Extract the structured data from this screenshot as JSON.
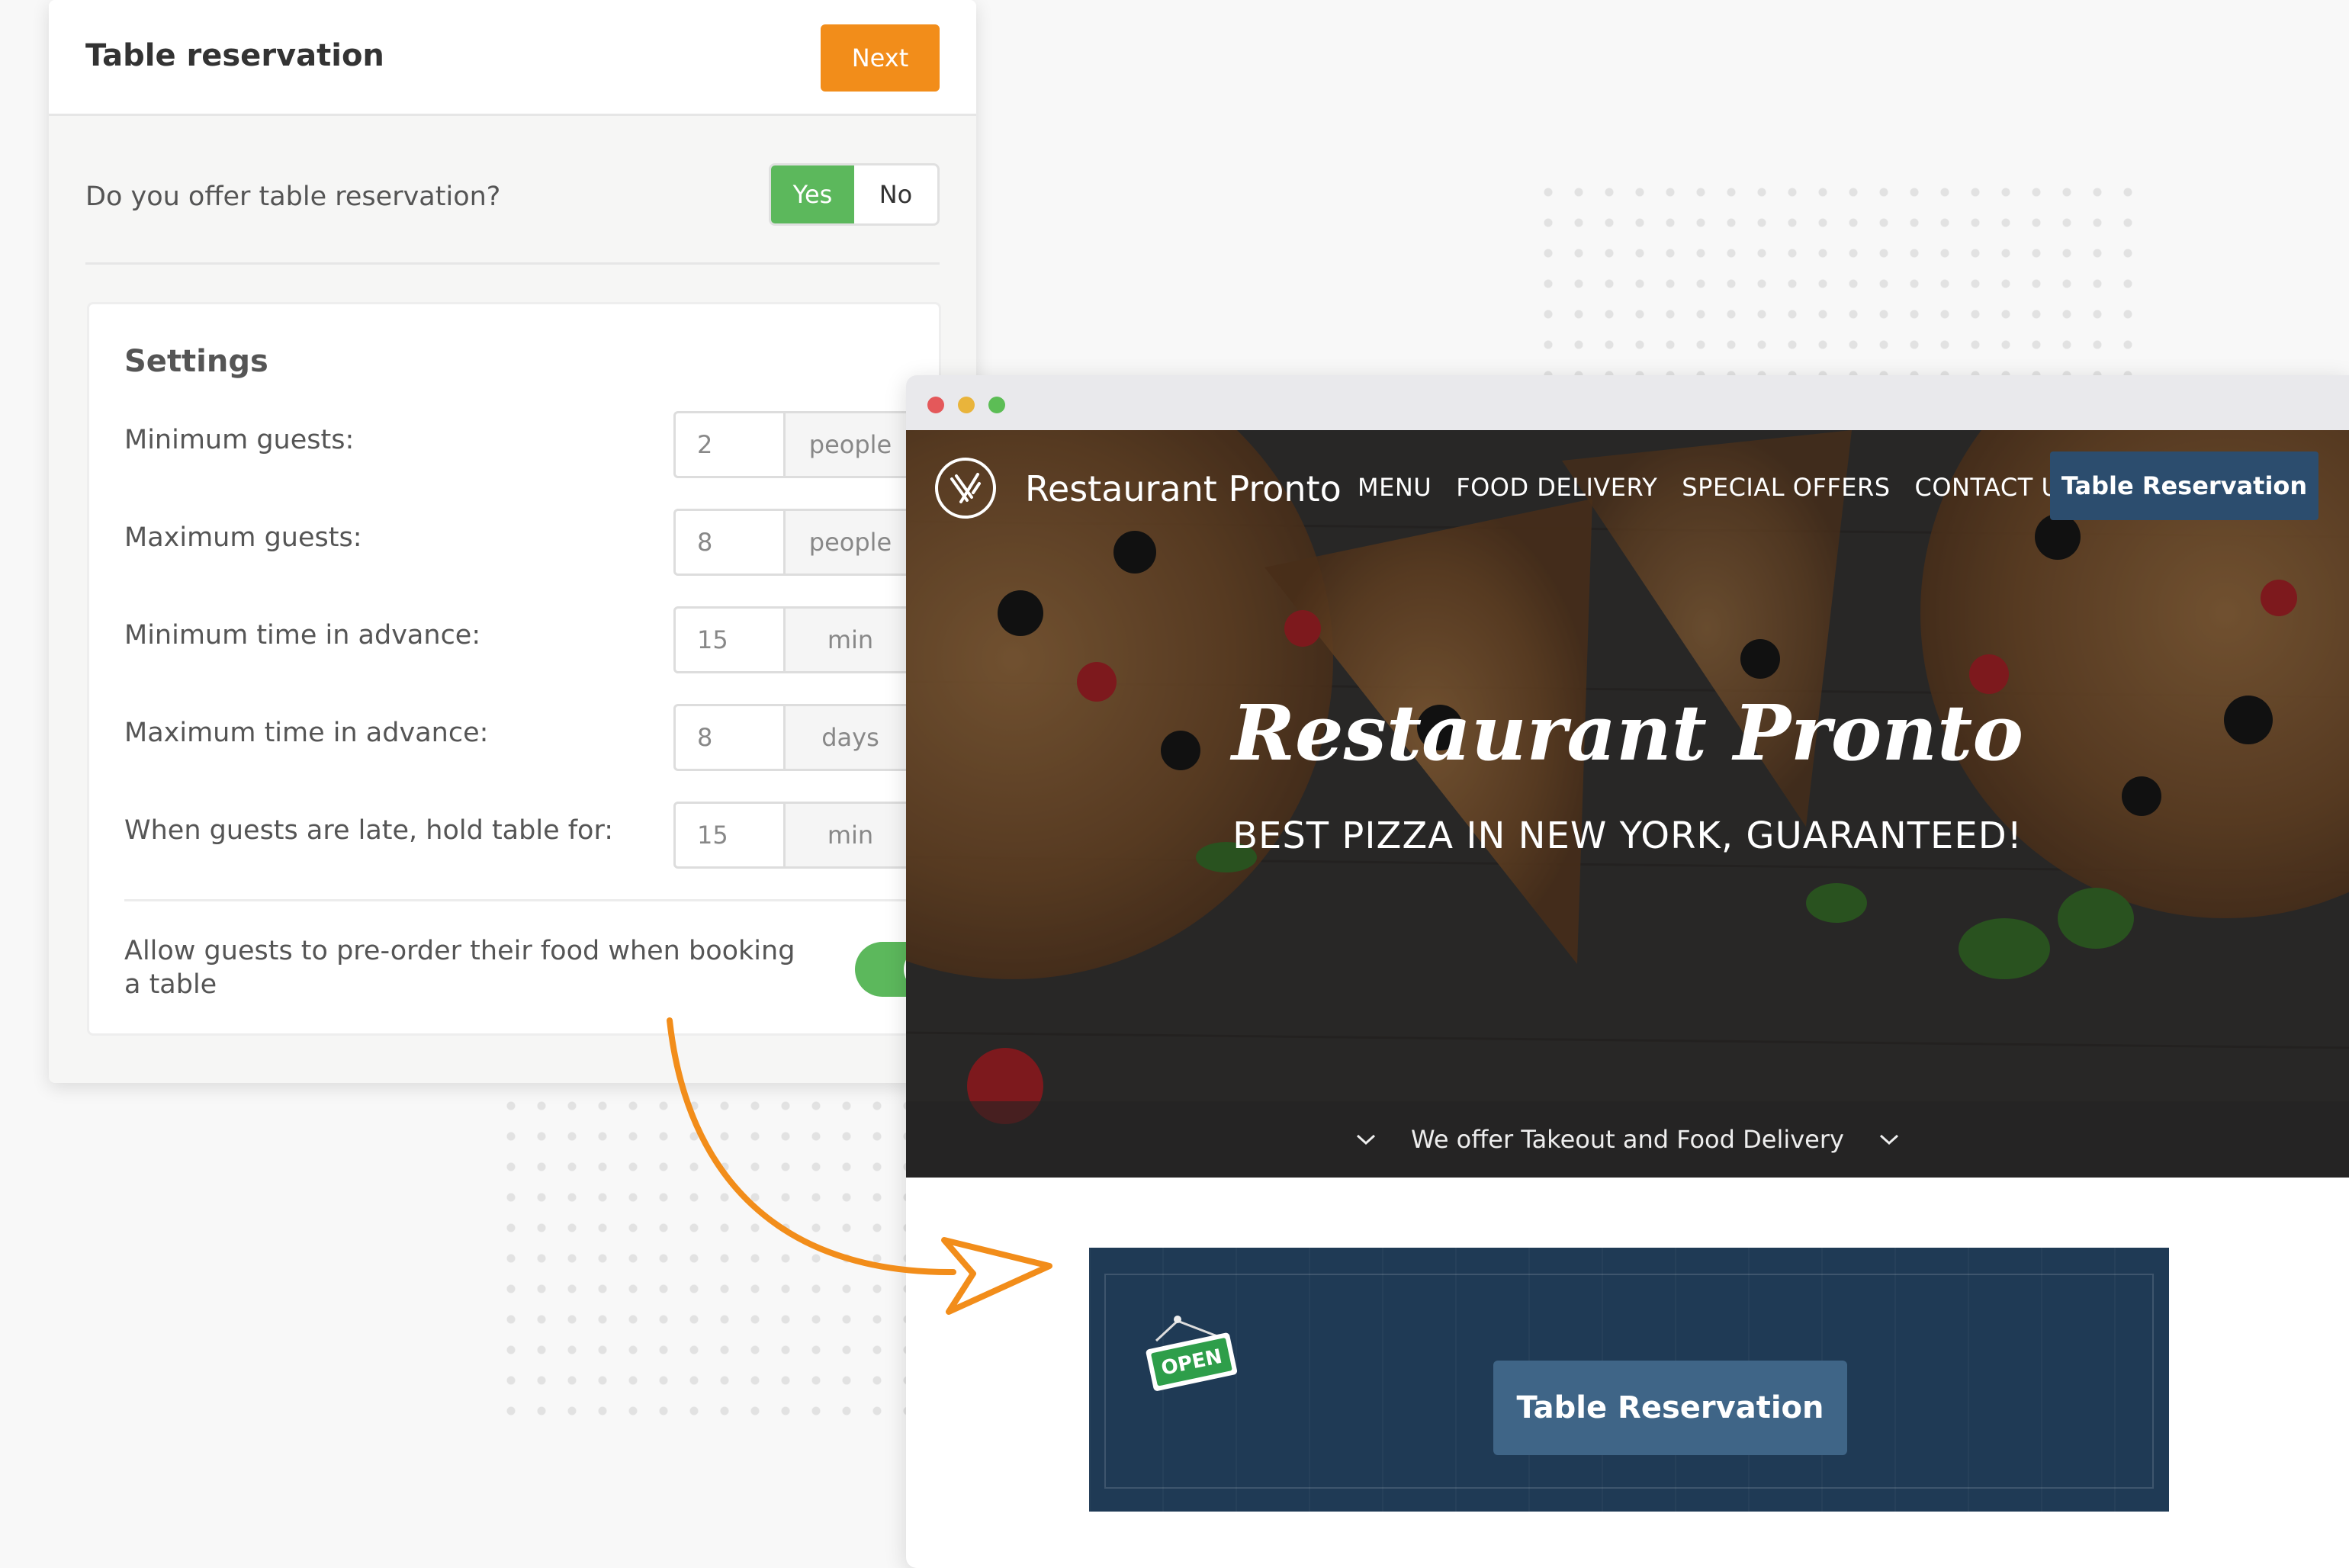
{
  "panel": {
    "title": "Table reservation",
    "next_label": "Next",
    "question": "Do you offer table reservation?",
    "yes_label": "Yes",
    "no_label": "No",
    "selected": "Yes"
  },
  "settings": {
    "title": "Settings",
    "rows": [
      {
        "label": "Minimum guests:",
        "value": "2",
        "unit": "people"
      },
      {
        "label": "Maximum guests:",
        "value": "8",
        "unit": "people"
      },
      {
        "label": "Minimum time in advance:",
        "value": "15",
        "unit": "min"
      },
      {
        "label": "Maximum time in advance:",
        "value": "8",
        "unit": "days"
      },
      {
        "label": "When guests are late, hold table for:",
        "value": "15",
        "unit": "min"
      }
    ],
    "preorder_label": "Allow guests to pre-order their food when booking a table",
    "preorder_enabled": true
  },
  "site": {
    "name": "Restaurant Pronto",
    "nav": [
      "MENU",
      "FOOD DELIVERY",
      "SPECIAL OFFERS",
      "CONTACT US"
    ],
    "nav_cta": "Table Reservation",
    "hero_title": "Restaurant Pronto",
    "hero_subtitle": "BEST PIZZA IN NEW YORK, GUARANTEED!",
    "strip_text": "We offer Takeout and Food Delivery",
    "open_sign": "OPEN",
    "reserve_button": "Table Reservation"
  },
  "colors": {
    "accent_orange": "#f28d1a",
    "toggle_green": "#5cb85c",
    "nav_blue": "#2c4d6e",
    "box_navy": "#1f3a55"
  },
  "icons": {
    "logo": "fork-knife-circle-icon",
    "strip_left": "chevron-down-icon",
    "strip_right": "chevron-down-icon",
    "arrow": "curved-arrow-icon"
  }
}
